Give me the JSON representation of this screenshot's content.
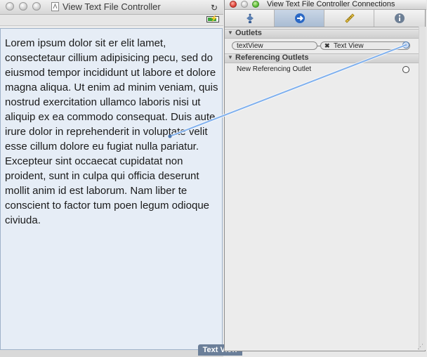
{
  "left_window": {
    "title": "View Text File Controller",
    "text_view": {
      "content": "Lorem ipsum dolor sit er elit lamet, consectetaur cillium adipisicing pecu, sed do eiusmod tempor incididunt ut labore et dolore magna aliqua. Ut enim ad minim veniam, quis nostrud exercitation ullamco laboris nisi ut aliquip ex ea commodo consequat. Duis aute irure dolor in reprehenderit in voluptate velit esse cillum dolore eu fugiat nulla pariatur. Excepteur sint occaecat cupidatat non proident, sunt in culpa qui officia deserunt mollit anim id est laborum. Nam liber te conscient to factor tum poen legum odioque civiuda."
    },
    "tag_label": "Text View"
  },
  "inspector": {
    "title": "View Text File Controller Connections",
    "tabs": [
      {
        "name": "attributes",
        "icon": "attributes-icon"
      },
      {
        "name": "connections",
        "icon": "connections-icon",
        "active": true
      },
      {
        "name": "size",
        "icon": "ruler-icon"
      },
      {
        "name": "identity",
        "icon": "info-icon"
      }
    ],
    "outlets_header": "Outlets",
    "outlet": {
      "name": "textView",
      "target": "Text View"
    },
    "referencing_header": "Referencing Outlets",
    "new_referencing_outlet": "New Referencing Outlet"
  },
  "colors": {
    "text_view_bg": "#e6edf6",
    "connection_line": "#7fb0ee",
    "active_tab": "#b9c9dd"
  }
}
